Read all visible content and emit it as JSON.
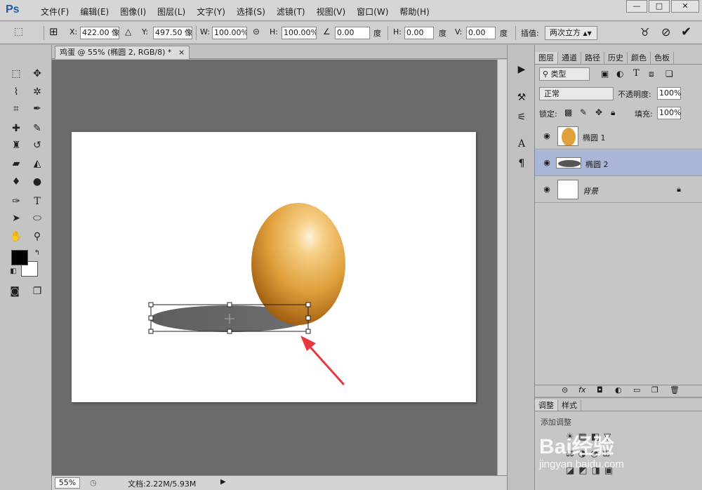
{
  "app": {
    "logo": "Ps"
  },
  "menu": [
    "文件(F)",
    "编辑(E)",
    "图像(I)",
    "图层(L)",
    "文字(Y)",
    "选择(S)",
    "滤镜(T)",
    "视图(V)",
    "窗口(W)",
    "帮助(H)"
  ],
  "window_controls": {
    "minimize": "—",
    "maximize": "□",
    "close": "✕"
  },
  "options": {
    "x_label": "X:",
    "x_value": "422.00 像",
    "y_label": "Y:",
    "y_value": "497.50 像",
    "w_label": "W:",
    "w_value": "100.00%",
    "h_label": "H:",
    "h_value": "100.00%",
    "angle_value": "0.00",
    "angle_unit": "度",
    "hskew_label": "H:",
    "hskew_value": "0.00",
    "hskew_unit": "度",
    "vskew_label": "V:",
    "vskew_value": "0.00",
    "vskew_unit": "度",
    "interp_label": "插值:",
    "interp_value": "两次立方"
  },
  "document": {
    "tab_title": "鸡蛋 @ 55% (椭圆 2, RGB/8) *",
    "zoom": "55%",
    "doc_size": "文档:2.22M/5.93M"
  },
  "panels": {
    "tabs": [
      "图层",
      "通道",
      "路径",
      "历史",
      "颜色",
      "色板"
    ],
    "filter_kind": "类型",
    "blend_mode": "正常",
    "opacity_label": "不透明度:",
    "opacity_value": "100%",
    "lock_label": "锁定:",
    "fill_label": "填充:",
    "fill_value": "100%",
    "layers": [
      {
        "name": "椭圆 1",
        "selected": false
      },
      {
        "name": "椭圆 2",
        "selected": true
      },
      {
        "name": "背景",
        "selected": false
      }
    ],
    "adjust_tabs": [
      "调整",
      "样式"
    ],
    "adjust_hint": "添加调整"
  },
  "watermark": {
    "brand": "Bai经验",
    "url": "jingyan.baidu.com"
  },
  "colors": {
    "accent": "#a9b6d6",
    "egg": "#e0a03c",
    "arrow": "#e8383d"
  }
}
